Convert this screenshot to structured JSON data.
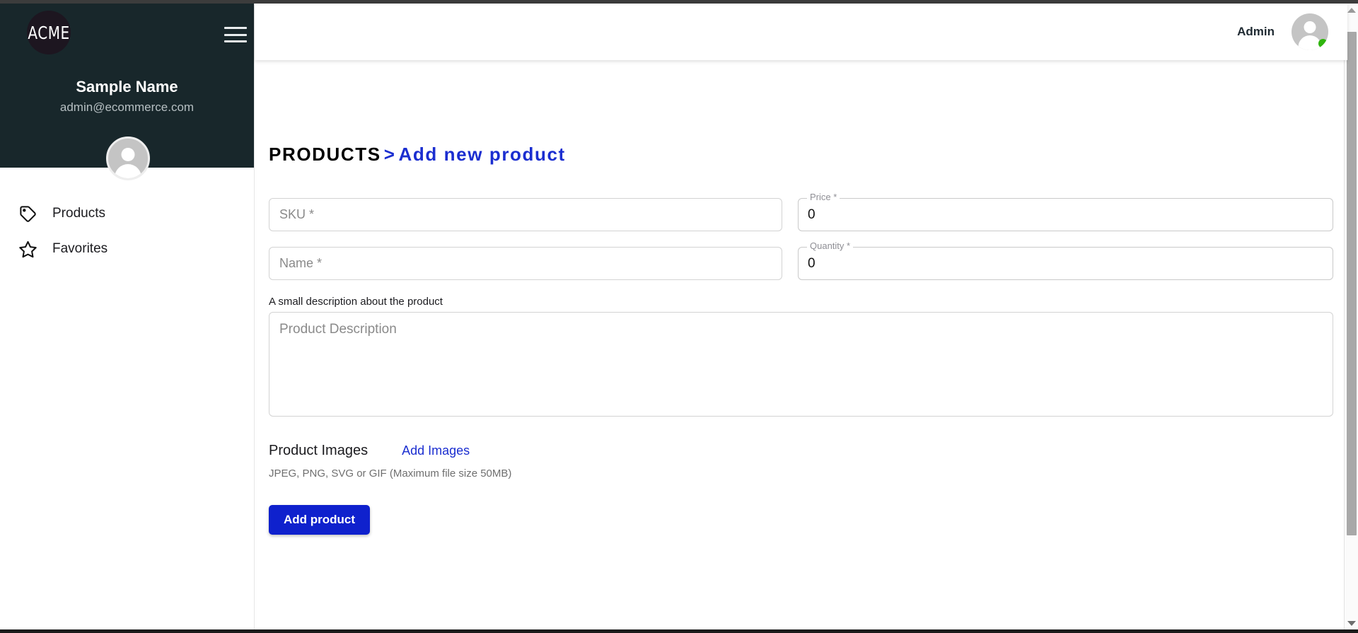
{
  "sidebar": {
    "logo_text": "ACME",
    "logo_icon": "acme-logo",
    "menu_icon": "hamburger-menu-icon",
    "user_name": "Sample Name",
    "user_email": "admin@ecommerce.com",
    "avatar_icon": "user-avatar-icon",
    "items": [
      {
        "label": "Products",
        "icon": "tag-icon"
      },
      {
        "label": "Favorites",
        "icon": "star-icon"
      }
    ]
  },
  "topbar": {
    "account_label": "Admin",
    "avatar_icon": "user-avatar-icon",
    "status_icon": "online-status-dot",
    "status_color": "#2fb50e"
  },
  "breadcrumb": {
    "root": "PRODUCTS",
    "separator": ">",
    "current": "Add new product",
    "accent_color": "#1b2ed0"
  },
  "form": {
    "sku": {
      "placeholder": "SKU *",
      "value": ""
    },
    "name": {
      "placeholder": "Name *",
      "value": ""
    },
    "price": {
      "label": "Price *",
      "value": "0"
    },
    "quantity": {
      "label": "Quantity *",
      "value": "0"
    },
    "description": {
      "label": "A small description about the product",
      "placeholder": "Product Description",
      "value": ""
    },
    "images": {
      "title": "Product Images",
      "add_link": "Add Images",
      "hint": "JPEG, PNG, SVG or GIF (Maximum file size 50MB)"
    },
    "submit_label": "Add product",
    "submit_color": "#0f21cd"
  },
  "scrollbar": {
    "up_icon": "scroll-up-arrow-icon",
    "down_icon": "scroll-down-arrow-icon"
  }
}
